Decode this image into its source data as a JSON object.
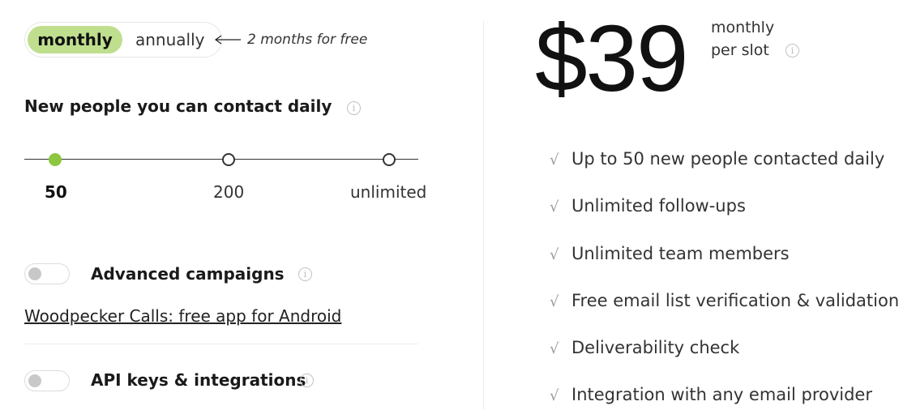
{
  "billing": {
    "monthly_label": "monthly",
    "annually_label": "annually",
    "promo": "2 months for free",
    "accent_color": "#bfdf8f"
  },
  "contacts": {
    "heading": "New people you can contact daily",
    "options": [
      "50",
      "200",
      "unlimited"
    ],
    "selected": "50",
    "slider_accent": "#8dc63f"
  },
  "addons": {
    "advanced_campaigns": {
      "label": "Advanced campaigns",
      "enabled": false
    },
    "calls_link": "Woodpecker Calls: free app for Android",
    "api_keys": {
      "label": "API keys & integrations",
      "enabled": false
    }
  },
  "price": {
    "amount": "$39",
    "period": "monthly",
    "unit": "per slot"
  },
  "features": [
    "Up to 50 new people contacted daily",
    "Unlimited follow-ups",
    "Unlimited team members",
    "Free email list verification & validation",
    "Deliverability check",
    "Integration with any email provider"
  ],
  "icons": {
    "info": "info-icon",
    "check": "checkmark-icon",
    "arrow": "arrow-left-icon"
  }
}
